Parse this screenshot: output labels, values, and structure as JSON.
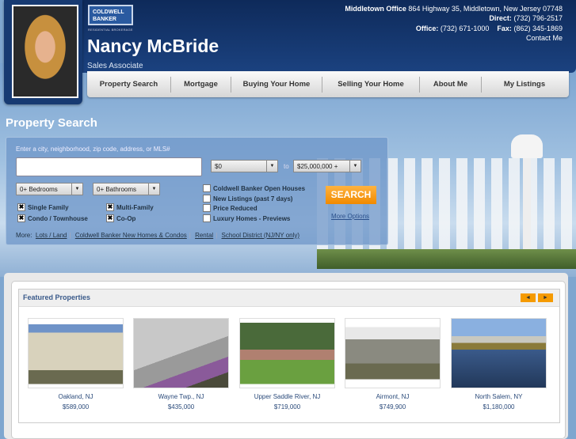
{
  "header": {
    "logo": "COLDWELL BANKER",
    "logo_sub": "RESIDENTIAL BROKERAGE",
    "name": "Nancy McBride",
    "title": "Sales Associate",
    "office_label": "Middletown Office",
    "office_address": "864 Highway 35, Middletown, New Jersey 07748",
    "direct_label": "Direct:",
    "direct": "(732) 796-2517",
    "office_phone_label": "Office:",
    "office_phone": "(732) 671-1000",
    "fax_label": "Fax:",
    "fax": "(862) 345-1869",
    "contact": "Contact Me"
  },
  "nav": [
    "Property Search",
    "Mortgage",
    "Buying Your Home",
    "Selling Your Home",
    "About Me",
    "My Listings"
  ],
  "search": {
    "title": "Property Search",
    "prompt": "Enter a city, neighborhood, zip code, address, or MLS#",
    "query": "",
    "min_price": "$0",
    "to": "to",
    "max_price": "$25,000,000 +",
    "bedrooms": "0+ Bedrooms",
    "bathrooms": "0+ Bathrooms",
    "types": [
      {
        "label": "Single Family",
        "checked": true
      },
      {
        "label": "Multi-Family",
        "checked": true
      },
      {
        "label": "Condo / Townhouse",
        "checked": true
      },
      {
        "label": "Co-Op",
        "checked": true
      }
    ],
    "filters": [
      {
        "label": "Coldwell Banker Open Houses",
        "checked": false
      },
      {
        "label": "New Listings (past 7 days)",
        "checked": false
      },
      {
        "label": "Price Reduced",
        "checked": false
      },
      {
        "label": "Luxury Homes - Previews",
        "checked": false
      }
    ],
    "button": "SEARCH",
    "more_options": "More Options",
    "more_label": "More:",
    "more_links": [
      "Lots / Land",
      "Coldwell Banker New Homes & Condos",
      "Rental",
      "School District (NJ/NY only)"
    ]
  },
  "featured": {
    "title": "Featured Properties",
    "prev": "◄",
    "next": "►",
    "items": [
      {
        "location": "Oakland, NJ",
        "price": "$589,000"
      },
      {
        "location": "Wayne Twp., NJ",
        "price": "$435,000"
      },
      {
        "location": "Upper Saddle River, NJ",
        "price": "$719,000"
      },
      {
        "location": "Airmont, NJ",
        "price": "$749,900"
      },
      {
        "location": "North Salem, NY",
        "price": "$1,180,000"
      }
    ]
  },
  "colors": {
    "header": "#12305f",
    "accent": "#f59a00"
  }
}
